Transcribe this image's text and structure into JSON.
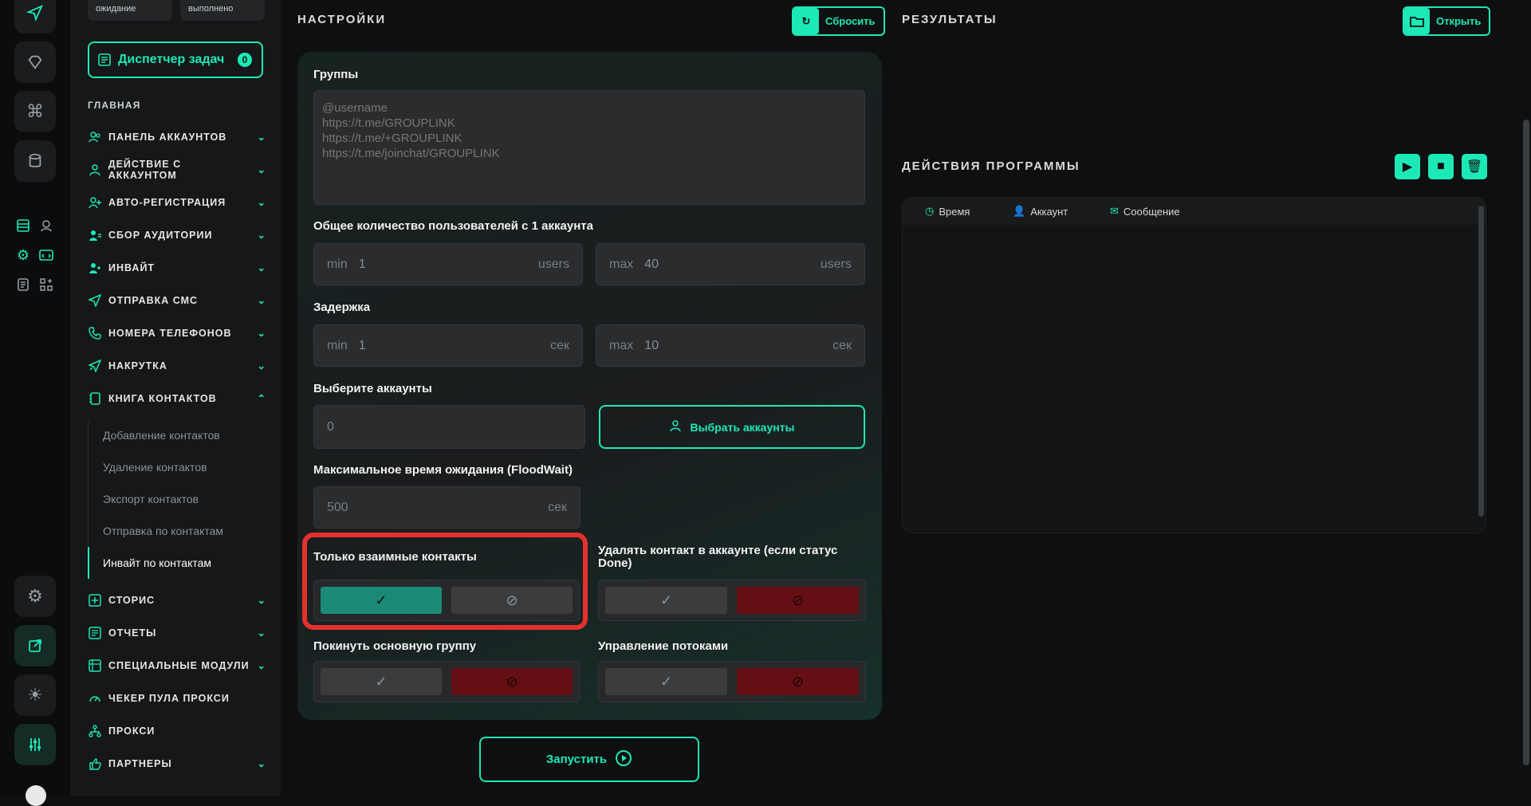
{
  "sidebar": {
    "pills": [
      "ожидание",
      "выполнено"
    ],
    "task_manager": {
      "label": "Диспетчер задач",
      "count": "0"
    },
    "section": "ГЛАВНАЯ",
    "items": [
      {
        "label": "ПАНЕЛЬ АККАУНТОВ",
        "icon": "users-icon"
      },
      {
        "label": "ДЕЙСТВИЕ С АККАУНТОМ",
        "icon": "user-icon"
      },
      {
        "label": "АВТО-РЕГИСТРАЦИЯ",
        "icon": "user-plus-icon"
      },
      {
        "label": "СБОР АУДИТОРИИ",
        "icon": "user-group-icon"
      },
      {
        "label": "ИНВАЙТ",
        "icon": "user-add-icon"
      },
      {
        "label": "ОТПРАВКА СМС",
        "icon": "send-icon"
      },
      {
        "label": "НОМЕРА ТЕЛЕФОНОВ",
        "icon": "phone-icon"
      },
      {
        "label": "НАКРУТКА",
        "icon": "boost-icon"
      },
      {
        "label": "КНИГА КОНТАКТОВ",
        "icon": "book-icon"
      }
    ],
    "contacts_sub": [
      "Добавление контактов",
      "Удаление контактов",
      "Экспорт контактов",
      "Отправка по контактам",
      "Инвайт по контактам"
    ],
    "items_after": [
      {
        "label": "СТОРИС",
        "icon": "story-icon"
      },
      {
        "label": "ОТЧЕТЫ",
        "icon": "report-icon"
      },
      {
        "label": "СПЕЦИАЛЬНЫЕ МОДУЛИ",
        "icon": "module-icon"
      },
      {
        "label": "ЧЕКЕР ПУЛА ПРОКСИ",
        "icon": "speed-icon"
      },
      {
        "label": "ПРОКСИ",
        "icon": "network-icon"
      },
      {
        "label": "ПАРТНЕРЫ",
        "icon": "partners-icon"
      }
    ]
  },
  "settings": {
    "title": "НАСТРОЙКИ",
    "reset_label": "Сбросить",
    "groups_label": "Группы",
    "groups_placeholder": "@username\nhttps://t.me/GROUPLINK\nhttps://t.me/+GROUPLINK\nhttps://t.me/joinchat/GROUPLINK",
    "users_label": "Общее количество пользователей с 1 аккаунта",
    "users_min": {
      "prefix": "min",
      "value": "1",
      "unit": "users"
    },
    "users_max": {
      "prefix": "max",
      "value": "40",
      "unit": "users"
    },
    "delay_label": "Задержка",
    "delay_min": {
      "prefix": "min",
      "value": "1",
      "unit": "сек"
    },
    "delay_max": {
      "prefix": "max",
      "value": "10",
      "unit": "сек"
    },
    "accounts_label": "Выберите аккаунты",
    "accounts_value": "0",
    "select_accounts": "Выбрать аккаунты",
    "floodwait_label": "Максимальное время ожидания (FloodWait)",
    "floodwait_value": "500",
    "floodwait_unit": "сек",
    "mutual_label": "Только взаимные контакты",
    "delete_label": "Удалять контакт в аккаунте (если статус Done)",
    "leave_label": "Покинуть основную группу",
    "threads_label": "Управление потоками",
    "run_label": "Запустить"
  },
  "results": {
    "title": "РЕЗУЛЬТАТЫ",
    "open_label": "Открыть",
    "actions_title": "ДЕЙСТВИЯ ПРОГРАММЫ",
    "columns": [
      "Время",
      "Аккаунт",
      "Сообщение"
    ]
  }
}
